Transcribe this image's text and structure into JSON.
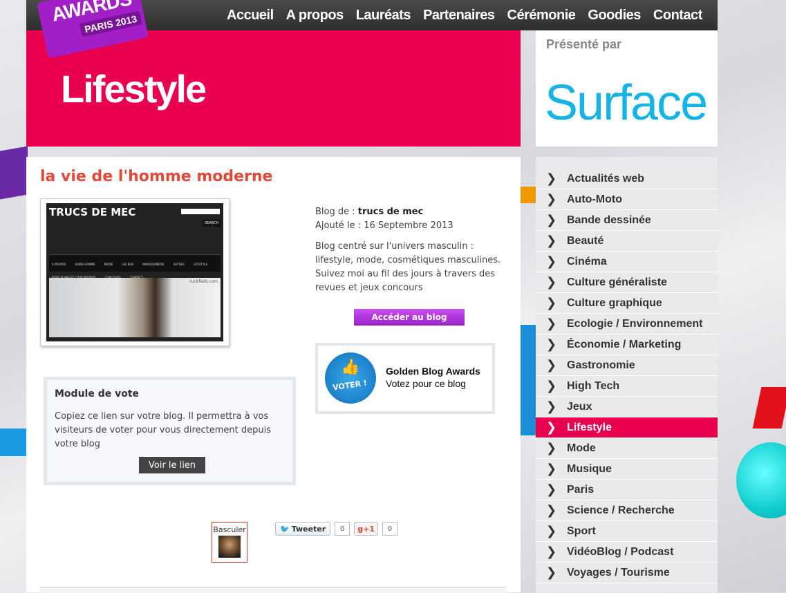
{
  "header": {
    "logo_line1": "AWARDS",
    "logo_line2": "PARIS 2013",
    "nav": [
      "Accueil",
      "A propos",
      "Lauréats",
      "Partenaires",
      "Cérémonie",
      "Goodies",
      "Contact"
    ]
  },
  "banner": {
    "title": "Lifestyle",
    "sponsor_label": "Présenté par",
    "sponsor_name": "Surface"
  },
  "post": {
    "title": "la vie de l'homme moderne",
    "thumbnail": {
      "site_title": "TRUCS DE MEC",
      "search_button": "SEARCH",
      "nav_items": [
        "A PROPOS",
        "SOINS HOMME",
        "MODE",
        "LES BOX",
        "MAROQUINERIE",
        "AUTRES",
        "LIFESTYLE",
        "BONS PLANS ET CODE PROMOS",
        "CONCOURS",
        "CONTACT"
      ],
      "photo_caption": "ruckfield.com"
    },
    "blog_label": "Blog de : ",
    "blog_name": "trucs de mec",
    "added_label": "Ajouté le : ",
    "added_date": "16 Septembre 2013",
    "description": "Blog centré sur l'univers masculin : lifestyle, mode, cosmétiques masculines. Suivez moi au fil des jours à travers des revues et jeux concours",
    "access_button": "Accéder au blog"
  },
  "vote": {
    "badge_text": "VOTER !",
    "title": "Golden Blog Awards",
    "subtitle": "Votez pour ce blog"
  },
  "module": {
    "title": "Module de vote",
    "text": "Copiez ce lien sur votre blog. Il permettra à vos visiteurs de voter pour vous directement depuis votre blog",
    "button": "Voir le lien"
  },
  "social": {
    "switch_label": "Basculer",
    "tweet_label": "Tweeter",
    "tweet_count": "0",
    "gplus_label": "+1",
    "gplus_count": "0"
  },
  "sidebar": {
    "categories": [
      {
        "label": "Actualités web",
        "active": false
      },
      {
        "label": "Auto-Moto",
        "active": false
      },
      {
        "label": "Bande dessinée",
        "active": false
      },
      {
        "label": "Beauté",
        "active": false
      },
      {
        "label": "Cinéma",
        "active": false
      },
      {
        "label": "Culture généraliste",
        "active": false
      },
      {
        "label": "Culture graphique",
        "active": false
      },
      {
        "label": "Ecologie / Environnement",
        "active": false
      },
      {
        "label": "Économie / Marketing",
        "active": false
      },
      {
        "label": "Gastronomie",
        "active": false
      },
      {
        "label": "High Tech",
        "active": false
      },
      {
        "label": "Jeux",
        "active": false
      },
      {
        "label": "Lifestyle",
        "active": true
      },
      {
        "label": "Mode",
        "active": false
      },
      {
        "label": "Musique",
        "active": false
      },
      {
        "label": "Paris",
        "active": false
      },
      {
        "label": "Science / Recherche",
        "active": false
      },
      {
        "label": "Sport",
        "active": false
      },
      {
        "label": "VidéoBlog / Podcast",
        "active": false
      },
      {
        "label": "Voyages / Tourisme",
        "active": false
      }
    ]
  },
  "colors": {
    "accent": "#e8004f",
    "title_red": "#e2493a",
    "sponsor_blue": "#16b4e6",
    "button_purple": "#a92fd8"
  }
}
